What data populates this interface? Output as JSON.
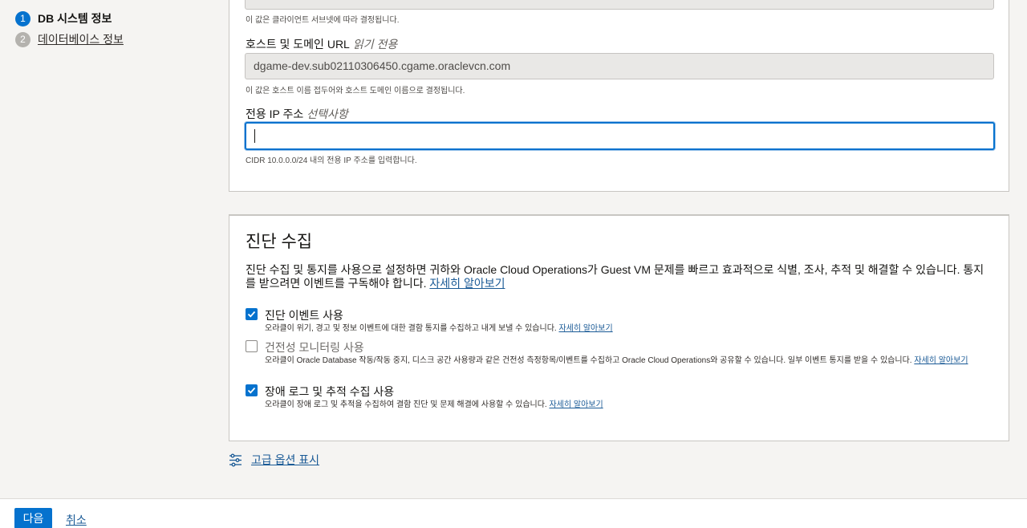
{
  "stepper": {
    "steps": [
      {
        "num": "1",
        "label": "DB 시스템 정보"
      },
      {
        "num": "2",
        "label": "데이터베이스 정보"
      }
    ]
  },
  "network": {
    "subnet_help": "이 값은 클라이언트 서브넷에 따라 결정됩니다.",
    "host_label": "호스트 및 도메인 URL",
    "host_tag": "읽기 전용",
    "host_value": "dgame-dev.sub02110306450.cgame.oraclevcn.com",
    "host_help": "이 값은 호스트 이름 접두어와 호스트 도메인 이름으로 결정됩니다.",
    "ip_label": "전용 IP 주소",
    "ip_tag": "선택사항",
    "ip_value": "",
    "ip_help": "CIDR 10.0.0.0/24 내의 전용 IP 주소를 입력합니다."
  },
  "diagnostics": {
    "title": "진단 수집",
    "description": "진단 수집 및 통지를 사용으로 설정하면 귀하와 Oracle Cloud Operations가 Guest VM 문제를 빠르고 효과적으로 식별, 조사, 추적 및 해결할 수 있습니다. 통지를 받으려면 이벤트를 구독해야 합니다.",
    "learn_more": "자세히 알아보기",
    "options": [
      {
        "label": "진단 이벤트 사용",
        "checked": true,
        "help": "오라클이 위기, 경고 및 정보 이벤트에 대한 결함 통지를 수집하고 내게 보낼 수 있습니다.",
        "link": "자세히 알아보기"
      },
      {
        "label": "건전성 모니터링 사용",
        "checked": false,
        "help": "오라클이 Oracle Database 작동/작동 중지, 디스크 공간 사용량과 같은 건전성 측정항목/이벤트를 수집하고 Oracle Cloud Operations와 공유할 수 있습니다. 일부 이벤트 통지를 받을 수 있습니다.",
        "link": "자세히 알아보기"
      },
      {
        "label": "장애 로그 및 추적 수집 사용",
        "checked": true,
        "help": "오라클이 장애 로그 및 추적을 수집하여 결함 진단 및 문제 해결에 사용할 수 있습니다.",
        "link": "자세히 알아보기"
      }
    ]
  },
  "advanced": {
    "label": "고급 옵션 표시"
  },
  "footer": {
    "next": "다음",
    "cancel": "취소"
  },
  "colors": {
    "accent": "#0572ce",
    "link": "#1a5a96"
  }
}
